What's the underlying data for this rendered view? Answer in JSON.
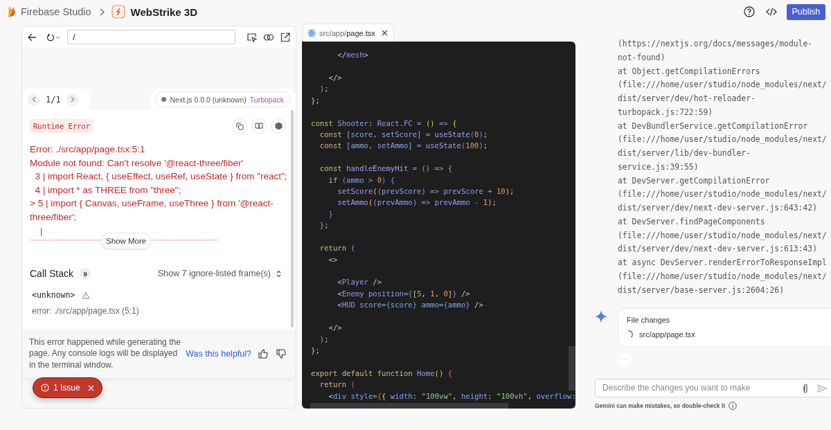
{
  "header": {
    "brand": "Firebase Studio",
    "project": "WebStrike 3D",
    "publish_button": "Publish"
  },
  "preview": {
    "url": "/",
    "error_overlay": {
      "pager": "1/1",
      "version": "Next.js 0.0.0 (unknown)",
      "bundler": "Turbopack",
      "badge": "Runtime Error",
      "message_lines": [
        "Error: ./src/app/page.tsx:5:1",
        "Module not found: Can't resolve '@react-three/fiber'",
        "  3 | import React, { useEffect, useRef, useState } from \"react\";",
        "  4 | import * as THREE from \"three\";",
        "> 5 | import { Canvas, useFrame, useThree } from '@react-",
        "three/fiber';",
        "    |"
      ],
      "carets_left": "^^^^^^^^^^^^^^^^^^^^^^^^^^^^^",
      "carets_right": "^^^^^^^^^^^^^^^^^^^^^^^^^^^",
      "show_more": "Show More",
      "call_stack": {
        "title": "Call Stack",
        "count": "9",
        "toggle": "Show 7 ignore-listed frame(s)",
        "frames": [
          {
            "name": "<unknown>",
            "location": "error: ./src/app/page.tsx (5:1)"
          }
        ]
      },
      "footer": "This error happened while generating the page. Any console logs will be displayed in the terminal window.",
      "feedback": "Was this helpful?"
    },
    "issues_button": "1 Issue"
  },
  "editor": {
    "tab": "src/app/**page.tsx**",
    "lines": [
      {
        "kind": "code",
        "tokens": [
          {
            "kind": "plain",
            "text": "      </"
          },
          {
            "kind": "tag",
            "text": "mesh"
          },
          {
            "kind": "plain",
            "text": ">"
          }
        ]
      },
      {
        "kind": "blank"
      },
      {
        "kind": "code",
        "tokens": [
          {
            "kind": "plain",
            "text": "    </>"
          }
        ]
      },
      {
        "kind": "code",
        "tokens": [
          {
            "kind": "brace3",
            "text": "  )"
          },
          {
            "kind": "plain",
            "text": ";"
          }
        ]
      },
      {
        "kind": "code",
        "tokens": [
          {
            "kind": "brace",
            "text": "}"
          },
          {
            "kind": "plain",
            "text": ";"
          }
        ]
      },
      {
        "kind": "blank"
      },
      {
        "kind": "code",
        "tokens": [
          {
            "kind": "keyword",
            "text": "const "
          },
          {
            "kind": "name",
            "text": "Shooter"
          },
          {
            "kind": "plain",
            "text": ": "
          },
          {
            "kind": "name",
            "text": "React.FC"
          },
          {
            "kind": "op",
            "text": " = "
          },
          {
            "kind": "brace",
            "text": "()"
          },
          {
            "kind": "op",
            "text": " => "
          },
          {
            "kind": "brace",
            "text": "{"
          }
        ]
      },
      {
        "kind": "code",
        "tokens": [
          {
            "kind": "keyword",
            "text": "  const "
          },
          {
            "kind": "name",
            "text": "[score, setScore]"
          },
          {
            "kind": "op",
            "text": " = "
          },
          {
            "kind": "func",
            "text": "useState"
          },
          {
            "kind": "brace2",
            "text": "("
          },
          {
            "kind": "number",
            "text": "0"
          },
          {
            "kind": "brace2",
            "text": ")"
          },
          {
            "kind": "plain",
            "text": ";"
          }
        ]
      },
      {
        "kind": "code",
        "tokens": [
          {
            "kind": "keyword",
            "text": "  const "
          },
          {
            "kind": "name",
            "text": "[ammo, setAmmo]"
          },
          {
            "kind": "op",
            "text": " = "
          },
          {
            "kind": "func",
            "text": "useState"
          },
          {
            "kind": "brace2",
            "text": "("
          },
          {
            "kind": "number",
            "text": "100"
          },
          {
            "kind": "brace2",
            "text": ")"
          },
          {
            "kind": "plain",
            "text": ";"
          }
        ]
      },
      {
        "kind": "blank"
      },
      {
        "kind": "code",
        "tokens": [
          {
            "kind": "keyword",
            "text": "  const "
          },
          {
            "kind": "func",
            "text": "handleEnemyHit"
          },
          {
            "kind": "op",
            "text": " = "
          },
          {
            "kind": "brace3",
            "text": "()"
          },
          {
            "kind": "op",
            "text": " => "
          },
          {
            "kind": "brace3",
            "text": "{"
          }
        ]
      },
      {
        "kind": "code",
        "tokens": [
          {
            "kind": "keyword",
            "text": "    if "
          },
          {
            "kind": "brace2",
            "text": "("
          },
          {
            "kind": "name",
            "text": "ammo"
          },
          {
            "kind": "op",
            "text": " > "
          },
          {
            "kind": "number",
            "text": "0"
          },
          {
            "kind": "brace2",
            "text": ") {"
          }
        ]
      },
      {
        "kind": "code",
        "tokens": [
          {
            "kind": "func",
            "text": "      setScore"
          },
          {
            "kind": "brace",
            "text": "("
          },
          {
            "kind": "brace3",
            "text": "("
          },
          {
            "kind": "name",
            "text": "prevScore"
          },
          {
            "kind": "brace3",
            "text": ")"
          },
          {
            "kind": "op",
            "text": " => "
          },
          {
            "kind": "name",
            "text": "prevScore"
          },
          {
            "kind": "op",
            "text": " + "
          },
          {
            "kind": "number",
            "text": "10"
          },
          {
            "kind": "brace",
            "text": ")"
          },
          {
            "kind": "plain",
            "text": ";"
          }
        ]
      },
      {
        "kind": "code",
        "tokens": [
          {
            "kind": "func",
            "text": "      setAmmo"
          },
          {
            "kind": "brace",
            "text": "("
          },
          {
            "kind": "brace3",
            "text": "("
          },
          {
            "kind": "name",
            "text": "prevAmmo"
          },
          {
            "kind": "brace3",
            "text": ")"
          },
          {
            "kind": "op",
            "text": " => "
          },
          {
            "kind": "name",
            "text": "prevAmmo"
          },
          {
            "kind": "op",
            "text": " - "
          },
          {
            "kind": "number",
            "text": "1"
          },
          {
            "kind": "brace",
            "text": ")"
          },
          {
            "kind": "plain",
            "text": ";"
          }
        ]
      },
      {
        "kind": "code",
        "tokens": [
          {
            "kind": "brace2",
            "text": "    }"
          }
        ]
      },
      {
        "kind": "code",
        "tokens": [
          {
            "kind": "brace3",
            "text": "  }"
          },
          {
            "kind": "plain",
            "text": ";"
          }
        ]
      },
      {
        "kind": "blank"
      },
      {
        "kind": "code",
        "tokens": [
          {
            "kind": "keyword",
            "text": "  return "
          },
          {
            "kind": "brace3",
            "text": "("
          }
        ]
      },
      {
        "kind": "code",
        "tokens": [
          {
            "kind": "plain",
            "text": "    <>"
          }
        ]
      },
      {
        "kind": "blank"
      },
      {
        "kind": "code",
        "tokens": [
          {
            "kind": "plain",
            "text": "      <"
          },
          {
            "kind": "tag",
            "text": "Player"
          },
          {
            "kind": "plain",
            "text": " />"
          }
        ]
      },
      {
        "kind": "code",
        "tokens": [
          {
            "kind": "plain",
            "text": "      <"
          },
          {
            "kind": "tag",
            "text": "Enemy"
          },
          {
            "kind": "name",
            "text": " position"
          },
          {
            "kind": "op",
            "text": "="
          },
          {
            "kind": "brace2",
            "text": "{"
          },
          {
            "kind": "brace",
            "text": "["
          },
          {
            "kind": "number",
            "text": "5"
          },
          {
            "kind": "plain",
            "text": ", "
          },
          {
            "kind": "number",
            "text": "1"
          },
          {
            "kind": "plain",
            "text": ", "
          },
          {
            "kind": "number",
            "text": "0"
          },
          {
            "kind": "brace",
            "text": "]"
          },
          {
            "kind": "brace2",
            "text": "}"
          },
          {
            "kind": "plain",
            "text": " />"
          }
        ]
      },
      {
        "kind": "code",
        "tokens": [
          {
            "kind": "plain",
            "text": "      <"
          },
          {
            "kind": "tag",
            "text": "HUD"
          },
          {
            "kind": "name",
            "text": " score"
          },
          {
            "kind": "op",
            "text": "="
          },
          {
            "kind": "brace2",
            "text": "{"
          },
          {
            "kind": "name",
            "text": "score"
          },
          {
            "kind": "brace2",
            "text": "}"
          },
          {
            "kind": "name",
            "text": " ammo"
          },
          {
            "kind": "op",
            "text": "="
          },
          {
            "kind": "brace2",
            "text": "{"
          },
          {
            "kind": "name",
            "text": "ammo"
          },
          {
            "kind": "brace2",
            "text": "}"
          },
          {
            "kind": "plain",
            "text": " />"
          }
        ]
      },
      {
        "kind": "blank"
      },
      {
        "kind": "code",
        "tokens": [
          {
            "kind": "plain",
            "text": "    </>"
          }
        ]
      },
      {
        "kind": "code",
        "tokens": [
          {
            "kind": "brace3",
            "text": "  )"
          },
          {
            "kind": "plain",
            "text": ";"
          }
        ]
      },
      {
        "kind": "code",
        "tokens": [
          {
            "kind": "brace",
            "text": "}"
          },
          {
            "kind": "plain",
            "text": ";"
          }
        ]
      },
      {
        "kind": "blank"
      },
      {
        "kind": "code",
        "tokens": [
          {
            "kind": "keyword",
            "text": "export default function "
          },
          {
            "kind": "name",
            "text": "Home"
          },
          {
            "kind": "brace",
            "text": "() "
          },
          {
            "kind": "brace4",
            "text": "{"
          }
        ]
      },
      {
        "kind": "code",
        "tokens": [
          {
            "kind": "keyword",
            "text": "  return "
          },
          {
            "kind": "brace4",
            "text": "("
          }
        ]
      },
      {
        "kind": "code",
        "tokens": [
          {
            "kind": "plain",
            "text": "    <"
          },
          {
            "kind": "tag",
            "text": "div"
          },
          {
            "kind": "name",
            "text": " style"
          },
          {
            "kind": "op",
            "text": "="
          },
          {
            "kind": "brace4",
            "text": "{"
          },
          {
            "kind": "brace",
            "text": "{"
          },
          {
            "kind": "name",
            "text": " width"
          },
          {
            "kind": "plain",
            "text": ": "
          },
          {
            "kind": "string",
            "text": "\"100vw\""
          },
          {
            "kind": "plain",
            "text": ", "
          },
          {
            "kind": "name",
            "text": "height"
          },
          {
            "kind": "plain",
            "text": ": "
          },
          {
            "kind": "string",
            "text": "\"100vh\""
          },
          {
            "kind": "plain",
            "text": ", "
          },
          {
            "kind": "name",
            "text": "overflow"
          },
          {
            "kind": "plain",
            "text": ":"
          }
        ]
      }
    ]
  },
  "chat": {
    "trace_lines": [
      "(https://nextjs.org/docs/messages/module-",
      "not-found)",
      "at Object.getCompilationErrors",
      "(file:///home/user/studio/node_modules/next/",
      "dist/server/dev/hot-reloader-",
      "turbopack.js:722:59)",
      "at DevBundlerService.getCompilationError",
      "(file:///home/user/studio/node_modules/next/",
      "dist/server/lib/dev-bundler-",
      "service.js:39:55)",
      "at DevServer.getCompilationError",
      "(file:///home/user/studio/node_modules/next/",
      "dist/server/dev/next-dev-server.js:643:42)",
      "at DevServer.findPageComponents",
      "(file:///home/user/studio/node_modules/next/",
      "dist/server/dev/next-dev-server.js:613:43)",
      "at async DevServer.renderErrorToResponseImpl",
      "(file:///home/user/studio/node_modules/next/",
      "dist/server/base-server.js:2604:26)"
    ],
    "file_changes": {
      "title": "File changes",
      "files": [
        "src/app/page.tsx"
      ]
    },
    "input": {
      "placeholder": "Describe the changes you want to make"
    },
    "disclaimer": "Gemini can make mistakes, so double-check it"
  }
}
